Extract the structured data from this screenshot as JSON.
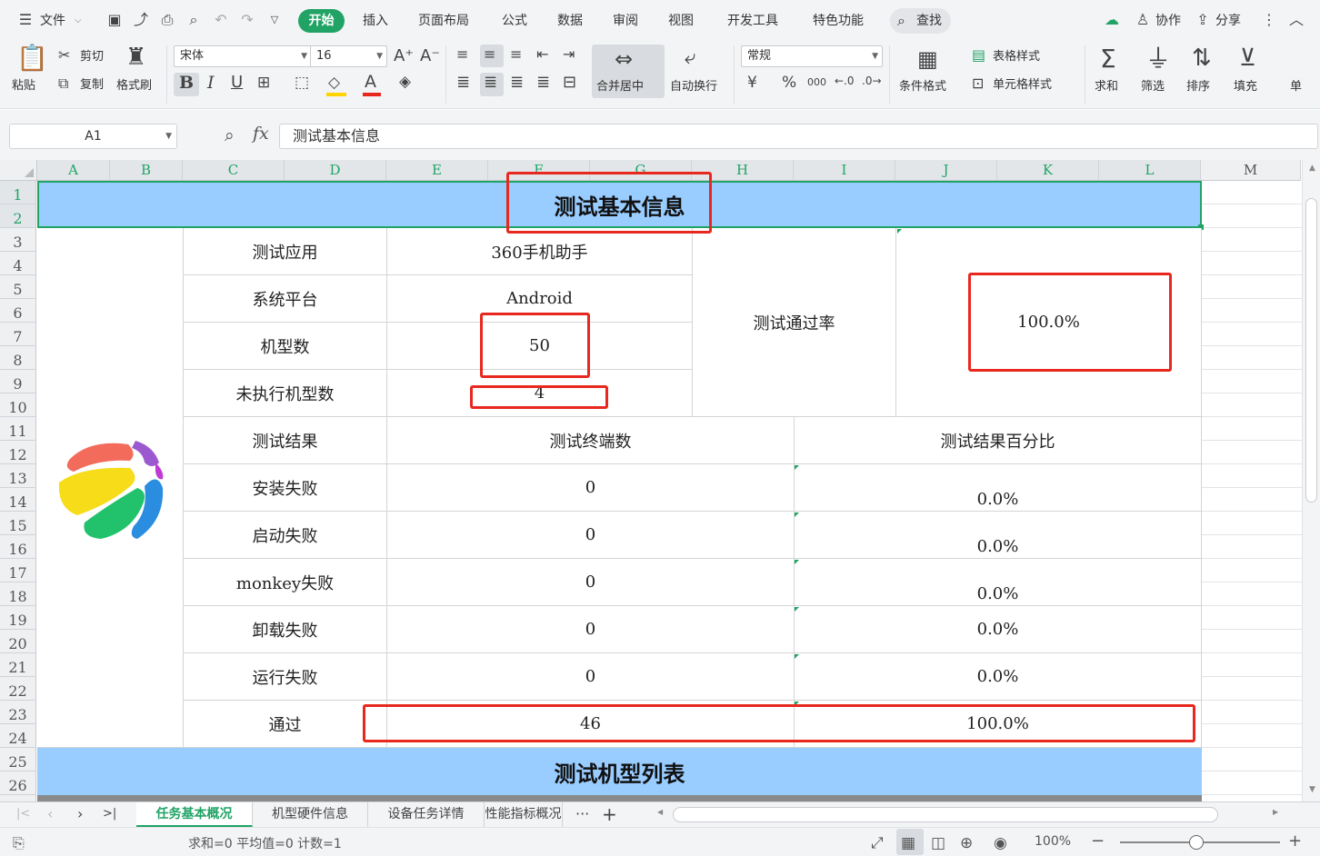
{
  "menu": {
    "file": "文件",
    "tabs": [
      "开始",
      "插入",
      "页面布局",
      "公式",
      "数据",
      "审阅",
      "视图",
      "开发工具",
      "特色功能"
    ],
    "search": "查找",
    "collab": "协作",
    "share": "分享"
  },
  "ribbon": {
    "paste": "粘贴",
    "cut": "剪切",
    "copy": "复制",
    "format_painter": "格式刷",
    "font_name": "宋体",
    "font_size": "16",
    "merge_center": "合并居中",
    "wrap_text": "自动换行",
    "number_format": "常规",
    "cond_format": "条件格式",
    "table_style": "表格样式",
    "cell_style": "单元格样式",
    "sum": "求和",
    "filter": "筛选",
    "sort": "排序",
    "fill": "填充",
    "single": "单",
    "bold": "B",
    "italic": "I",
    "underline": "U",
    "font_color": "A",
    "currency": "¥",
    "percent": "%",
    "thousands": "000"
  },
  "formula_bar": {
    "name_box": "A1",
    "fx": "fx",
    "content": "测试基本信息"
  },
  "columns": [
    "A",
    "B",
    "C",
    "D",
    "E",
    "F",
    "G",
    "H",
    "I",
    "J",
    "K",
    "L",
    "M"
  ],
  "rows": [
    "1",
    "2",
    "3",
    "4",
    "5",
    "6",
    "7",
    "8",
    "9",
    "10",
    "11",
    "12",
    "13",
    "14",
    "15",
    "16",
    "17",
    "18",
    "19",
    "20",
    "21",
    "22",
    "23",
    "24",
    "25",
    "26"
  ],
  "sheet": {
    "title": "测试基本信息",
    "app_label": "测试应用",
    "app_value": "360手机助手",
    "platform_label": "系统平台",
    "platform_value": "Android",
    "models_label": "机型数",
    "models_value": "50",
    "unexec_label": "未执行机型数",
    "unexec_value": "4",
    "pass_rate_label": "测试通过率",
    "pass_rate_value": "100.0%",
    "result_header": "测试结果",
    "terminals_header": "测试终端数",
    "percent_header": "测试结果百分比",
    "results": [
      {
        "label": "安装失败",
        "count": "0",
        "pct": "0.0%"
      },
      {
        "label": "启动失败",
        "count": "0",
        "pct": "0.0%"
      },
      {
        "label": "monkey失败",
        "count": "0",
        "pct": "0.0%"
      },
      {
        "label": "卸载失败",
        "count": "0",
        "pct": "0.0%"
      },
      {
        "label": "运行失败",
        "count": "0",
        "pct": "0.0%"
      },
      {
        "label": "通过",
        "count": "46",
        "pct": "100.0%"
      }
    ],
    "list_title": "测试机型列表"
  },
  "sheet_tabs": [
    "任务基本概况",
    "机型硬件信息",
    "设备任务详情",
    "性能指标概况"
  ],
  "status": {
    "summary": "求和=0  平均值=0  计数=1",
    "zoom": "100%"
  },
  "colors": {
    "accent": "#21a366",
    "banner": "#99ccff",
    "annotation": "#e8281e"
  }
}
